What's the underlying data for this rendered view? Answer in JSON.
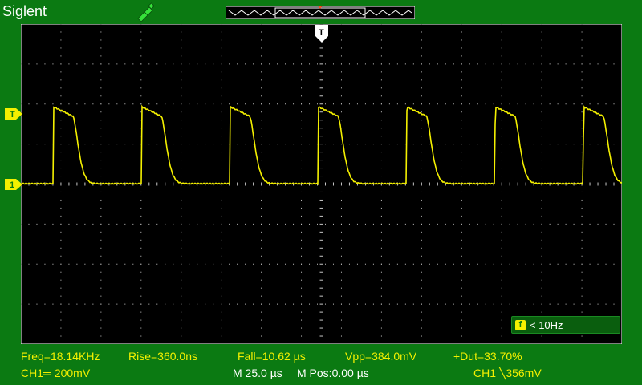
{
  "header": {
    "brand": "Siglent",
    "usb_icon": "usb-icon",
    "memory_bar_icon": "memory-depth-bar"
  },
  "markers": {
    "trigger_level_label": "T",
    "channel1_ground_label": "1",
    "trigger_position_label": "T"
  },
  "freq_counter": {
    "icon_label": "f",
    "value": "< 10Hz"
  },
  "measurements": {
    "freq": "Freq=18.14KHz",
    "rise": "Rise=360.0ns",
    "fall": "Fall=10.62 µs",
    "vpp": "Vpp=384.0mV",
    "duty": "+Dut=33.70%"
  },
  "status": {
    "ch1_scale": "CH1═ 200mV",
    "timebase": "M 25.0 µs",
    "mpos": "M Pos:0.00 µs",
    "trigger": "CH1 ╲356mV"
  },
  "waveform": {
    "channel": "CH1",
    "frequency_khz": 18.14,
    "vpp_mv": 384.0,
    "duty_percent": 33.7,
    "volts_per_div_mv": 200,
    "time_per_div_us": 25.0
  },
  "colors": {
    "background": "#0b7a12",
    "grid_area": "#000000",
    "trace": "#f4f000",
    "grid_dots": "#c8c8c8",
    "text_white": "#ffffff",
    "text_yellow": "#f4f000"
  }
}
